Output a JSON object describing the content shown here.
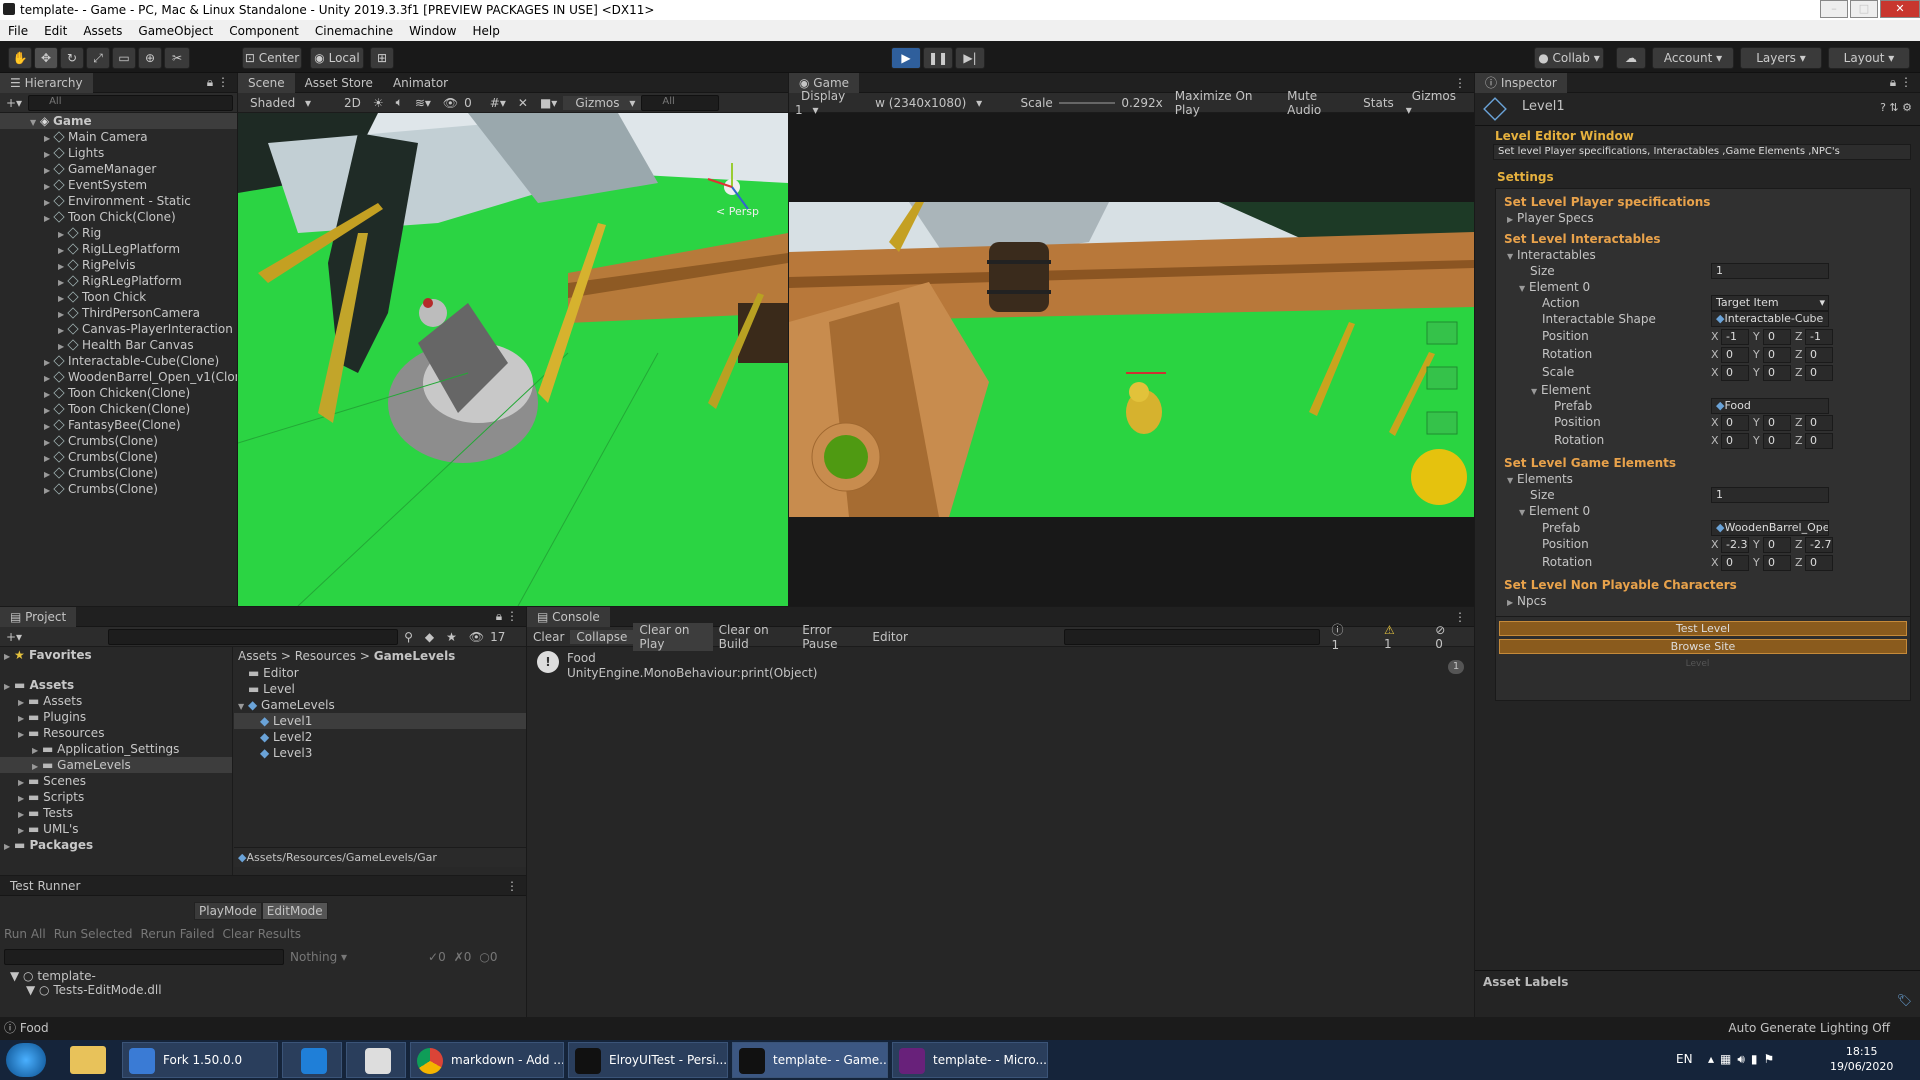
{
  "window": {
    "title": "template- - Game - PC, Mac & Linux Standalone - Unity 2019.3.3f1 [PREVIEW PACKAGES IN USE] <DX11>"
  },
  "menu": [
    "File",
    "Edit",
    "Assets",
    "GameObject",
    "Component",
    "Cinemachine",
    "Window",
    "Help"
  ],
  "toolbar": {
    "center": "Center",
    "local": "Local",
    "collab": "Collab",
    "account": "Account",
    "layers": "Layers",
    "layout": "Layout"
  },
  "hierarchy": {
    "tab": "Hierarchy",
    "search": "All",
    "root": "Game",
    "items": [
      {
        "label": "Main Camera",
        "indent": 1
      },
      {
        "label": "Lights",
        "indent": 1
      },
      {
        "label": "GameManager",
        "indent": 1
      },
      {
        "label": "EventSystem",
        "indent": 1
      },
      {
        "label": "Environment - Static",
        "indent": 1
      },
      {
        "label": "Toon Chick(Clone)",
        "indent": 1
      },
      {
        "label": "Rig",
        "indent": 2
      },
      {
        "label": "RigLLegPlatform",
        "indent": 2
      },
      {
        "label": "RigPelvis",
        "indent": 2
      },
      {
        "label": "RigRLegPlatform",
        "indent": 2
      },
      {
        "label": "Toon Chick",
        "indent": 2
      },
      {
        "label": "ThirdPersonCamera",
        "indent": 2
      },
      {
        "label": "Canvas-PlayerInteraction",
        "indent": 2
      },
      {
        "label": "Health Bar Canvas",
        "indent": 2
      },
      {
        "label": "Interactable-Cube(Clone)",
        "indent": 1
      },
      {
        "label": "WoodenBarrel_Open_v1(Clon",
        "indent": 1
      },
      {
        "label": "Toon Chicken(Clone)",
        "indent": 1
      },
      {
        "label": "Toon Chicken(Clone)",
        "indent": 1
      },
      {
        "label": "FantasyBee(Clone)",
        "indent": 1
      },
      {
        "label": "Crumbs(Clone)",
        "indent": 1
      },
      {
        "label": "Crumbs(Clone)",
        "indent": 1
      },
      {
        "label": "Crumbs(Clone)",
        "indent": 1
      },
      {
        "label": "Crumbs(Clone)",
        "indent": 1
      }
    ]
  },
  "scene": {
    "tabs": [
      "Scene",
      "Asset Store",
      "Animator"
    ],
    "shading": "Shaded",
    "mode2d": "2D",
    "fx_count": "0",
    "gizmos": "Gizmos",
    "search": "All",
    "persp": "< Persp"
  },
  "game": {
    "tab": "Game",
    "display": "Display 1",
    "resolution": "w (2340x1080)",
    "scale_label": "Scale",
    "scale_value": "0.292x",
    "maximize": "Maximize On Play",
    "mute": "Mute Audio",
    "stats": "Stats",
    "gizmos": "Gizmos"
  },
  "inspector": {
    "tab": "Inspector",
    "object": "Level1",
    "window_title": "Level Editor Window",
    "description": "Set level Player specifications, Interactables ,Game Elements ,NPC's",
    "settings": "Settings",
    "sec_player": "Set Level Player specifications",
    "player_specs": "Player Specs",
    "sec_interact": "Set Level Interactables",
    "interactables": "Interactables",
    "size": "Size",
    "size_val": "1",
    "element0": "Element 0",
    "action": "Action",
    "action_val": "Target Item",
    "shape": "Interactable Shape",
    "shape_val": "Interactable-Cube",
    "position": "Position",
    "rotation": "Rotation",
    "scale": "Scale",
    "element": "Element",
    "prefab": "Prefab",
    "food_val": "Food",
    "pos1": {
      "x": "-1",
      "y": "0",
      "z": "-1"
    },
    "rot1": {
      "x": "0",
      "y": "0",
      "z": "0"
    },
    "scl1": {
      "x": "0",
      "y": "0",
      "z": "0"
    },
    "pos2": {
      "x": "0",
      "y": "0",
      "z": "0"
    },
    "rot2": {
      "x": "0",
      "y": "0",
      "z": "0"
    },
    "sec_game": "Set Level Game Elements",
    "elements": "Elements",
    "size2_val": "1",
    "barrel_val": "WoodenBarrel_Oper",
    "pos3": {
      "x": "-2.31",
      "y": "0",
      "z": "-2.73"
    },
    "rot3": {
      "x": "0",
      "y": "0",
      "z": "0"
    },
    "sec_npc": "Set Level Non Playable Characters",
    "npcs": "Npcs",
    "test_level": "Test Level",
    "browse_site": "Browse Site",
    "level_footer": "Level",
    "asset_labels": "Asset Labels"
  },
  "project": {
    "tab": "Project",
    "count": "17",
    "favorites": "Favorites",
    "tree": [
      {
        "label": "Assets",
        "indent": 0,
        "bold": true
      },
      {
        "label": "Assets",
        "indent": 1
      },
      {
        "label": "Plugins",
        "indent": 1
      },
      {
        "label": "Resources",
        "indent": 1
      },
      {
        "label": "Application_Settings",
        "indent": 2
      },
      {
        "label": "GameLevels",
        "indent": 2
      },
      {
        "label": "Scenes",
        "indent": 1
      },
      {
        "label": "Scripts",
        "indent": 1
      },
      {
        "label": "Tests",
        "indent": 1
      },
      {
        "label": "UML's",
        "indent": 1
      },
      {
        "label": "Packages",
        "indent": 0,
        "bold": true
      }
    ],
    "breadcrumb": [
      "Assets",
      "Resources",
      "GameLevels"
    ],
    "files": [
      {
        "label": "Editor",
        "type": "folder"
      },
      {
        "label": "Level",
        "type": "folder"
      },
      {
        "label": "GameLevels",
        "type": "asset"
      },
      {
        "label": "Level1",
        "type": "asset"
      },
      {
        "label": "Level2",
        "type": "asset"
      },
      {
        "label": "Level3",
        "type": "asset"
      }
    ],
    "path": "Assets/Resources/GameLevels/Gar"
  },
  "console": {
    "tab": "Console",
    "buttons": [
      "Clear",
      "Collapse",
      "Clear on Play",
      "Clear on Build",
      "Error Pause",
      "Editor"
    ],
    "count_info": "1",
    "count_warn": "1",
    "count_err": "0",
    "log_line1": "Food",
    "log_line2": "UnityEngine.MonoBehaviour:print(Object)",
    "log_count": "1"
  },
  "testrunner": {
    "tab": "Test Runner",
    "playmode": "PlayMode",
    "editmode": "EditMode",
    "actions": [
      "Run All",
      "Run Selected",
      "Rerun Failed",
      "Clear Results"
    ],
    "filter": "Nothing",
    "pass": "0",
    "fail": "0",
    "skip": "0",
    "tree1": "template-",
    "tree2": "Tests-EditMode.dll"
  },
  "status": {
    "message": "Food",
    "lighting": "Auto Generate Lighting Off"
  },
  "taskbar": {
    "items": [
      "Fork 1.50.0.0",
      "",
      "",
      "markdown - Add ...",
      "ElroyUITest - Persi...",
      "template- - Game...",
      "template- - Micro..."
    ],
    "lang": "EN",
    "time": "18:15",
    "date": "19/06/2020"
  },
  "colors": {
    "accent_orange": "#e8a24b",
    "play_blue": "#2f5f9c",
    "grass": "#2ad441"
  }
}
